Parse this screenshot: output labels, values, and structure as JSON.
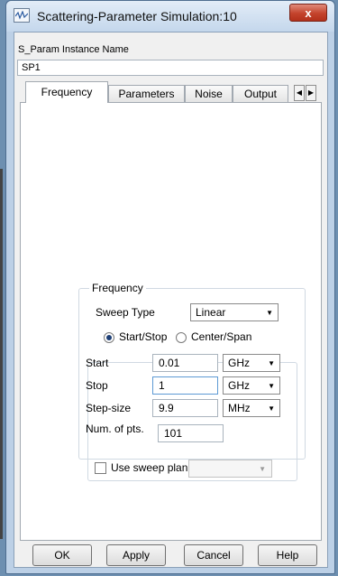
{
  "window": {
    "title": "Scattering-Parameter Simulation:10",
    "close_symbol": "x"
  },
  "instance": {
    "label": "S_Param Instance Name",
    "value": "SP1"
  },
  "tabs": [
    {
      "label": "Frequency",
      "active": true
    },
    {
      "label": "Parameters",
      "active": false
    },
    {
      "label": "Noise",
      "active": false
    },
    {
      "label": "Output",
      "active": false
    }
  ],
  "tab_scroll": {
    "left": "◀",
    "right": "▶"
  },
  "frequency": {
    "group_title": "Frequency",
    "sweep_type_label": "Sweep Type",
    "sweep_type_value": "Linear",
    "mode_start_stop": "Start/Stop",
    "mode_center_span": "Center/Span",
    "selected_mode": "Start/Stop",
    "start_label": "Start",
    "start_value": "0.01",
    "start_unit": "GHz",
    "stop_label": "Stop",
    "stop_value": "1",
    "stop_unit": "GHz",
    "step_label": "Step-size",
    "step_value": "9.9",
    "step_unit": "MHz",
    "numpts_label": "Num. of pts.",
    "numpts_value": "101",
    "use_sweep_plan_label": "Use sweep plan",
    "use_sweep_plan_checked": false
  },
  "buttons": {
    "ok": "OK",
    "apply": "Apply",
    "cancel": "Cancel",
    "help": "Help"
  },
  "colors": {
    "title_bar": "#c4d7ec",
    "close_button": "#c4432c",
    "radio_dot": "#1d3f76"
  }
}
